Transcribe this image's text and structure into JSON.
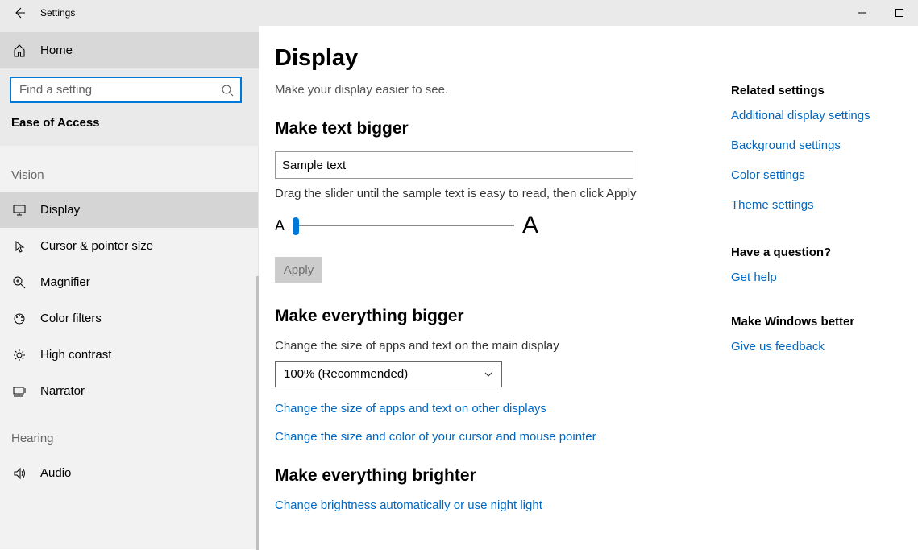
{
  "titlebar": {
    "app_name": "Settings"
  },
  "sidebar": {
    "home": "Home",
    "search_placeholder": "Find a setting",
    "section": "Ease of Access",
    "groups": {
      "vision": {
        "label": "Vision",
        "items": [
          {
            "label": "Display"
          },
          {
            "label": "Cursor & pointer size"
          },
          {
            "label": "Magnifier"
          },
          {
            "label": "Color filters"
          },
          {
            "label": "High contrast"
          },
          {
            "label": "Narrator"
          }
        ]
      },
      "hearing": {
        "label": "Hearing",
        "items": [
          {
            "label": "Audio"
          }
        ]
      }
    }
  },
  "main": {
    "title": "Display",
    "subtitle": "Make your display easier to see.",
    "text_bigger": {
      "heading": "Make text bigger",
      "sample": "Sample text",
      "hint": "Drag the slider until the sample text is easy to read, then click Apply",
      "small_a": "A",
      "big_a": "A",
      "apply": "Apply"
    },
    "everything_bigger": {
      "heading": "Make everything bigger",
      "hint": "Change the size of apps and text on the main display",
      "dropdown_value": "100% (Recommended)",
      "link1": "Change the size of apps and text on other displays",
      "link2": "Change the size and color of your cursor and mouse pointer"
    },
    "brighter": {
      "heading": "Make everything brighter",
      "link": "Change brightness automatically or use night light"
    }
  },
  "aside": {
    "related": {
      "heading": "Related settings",
      "links": [
        "Additional display settings",
        "Background settings",
        "Color settings",
        "Theme settings"
      ]
    },
    "question": {
      "heading": "Have a question?",
      "link": "Get help"
    },
    "better": {
      "heading": "Make Windows better",
      "link": "Give us feedback"
    }
  }
}
